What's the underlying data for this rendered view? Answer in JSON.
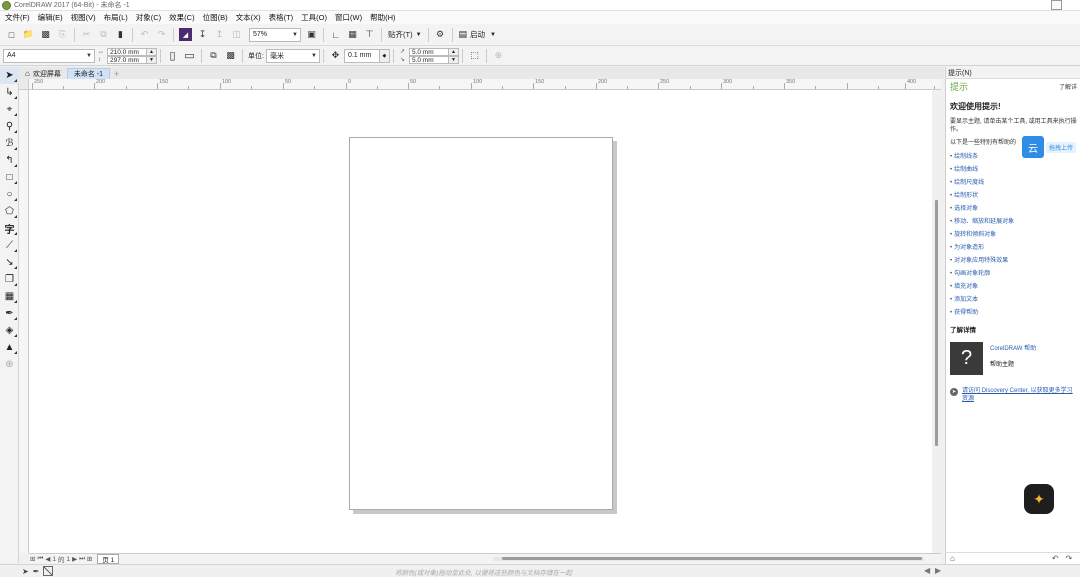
{
  "window": {
    "title": "CorelDRAW 2017 (64-Bit) - 未命名 -1"
  },
  "menu": [
    "文件(F)",
    "编辑(E)",
    "视图(V)",
    "布局(L)",
    "对象(C)",
    "效果(C)",
    "位图(B)",
    "文本(X)",
    "表格(T)",
    "工具(O)",
    "窗口(W)",
    "帮助(H)"
  ],
  "toolbar": {
    "zoom": "57%",
    "snap_label": "贴齐(T)",
    "launch_label": "启动"
  },
  "property_bar": {
    "page_size": "A4",
    "width": "210.0 mm",
    "height": "297.0 mm",
    "unit_label": "单位:",
    "unit": "毫米",
    "nudge": "0.1 mm",
    "dup_x": "5.0 mm",
    "dup_y": "5.0 mm"
  },
  "doc_tabs": {
    "welcome": "欢迎屏幕",
    "document": "未命名 -1"
  },
  "ruler": {
    "labels": [
      "250",
      "200",
      "150",
      "100",
      "50",
      "0",
      "50",
      "100",
      "150",
      "200",
      "250",
      "300",
      "350",
      "400"
    ]
  },
  "page_nav": {
    "current": "1",
    "of_label": "的",
    "total": "1",
    "page_tab": "页 1"
  },
  "status": {
    "hint": "将颜色(或对象)拖动至此处, 以便将这些颜色与文档存储在一起"
  },
  "docker": {
    "header": "提示(N)",
    "title": "提示",
    "learn_more": "了解详",
    "welcome": "欢迎使用提示!",
    "intro": "要显示主题, 请单击某个工具, 或用工具来执行操作。",
    "intro2": "以下是一些特别有帮助的",
    "cloud_label": "拖拽上传",
    "links": [
      "绘制线条",
      "绘制曲线",
      "绘制尺度线",
      "绘制形状",
      "选择对象",
      "移动、缩放和延展对象",
      "旋转和倾斜对象",
      "为对象造形",
      "对对象应用特殊效果",
      "勾画对象轮廓",
      "填充对象",
      "添加文本",
      "获得帮助"
    ],
    "more_section": "了解详情",
    "help_link": "CorelDRAW 帮助",
    "help_topic": "帮助主题",
    "discovery": "请访问 Discovery Center, 以获取更多学习资源"
  }
}
